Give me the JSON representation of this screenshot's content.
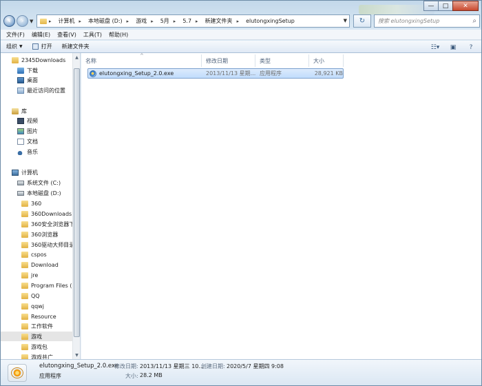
{
  "window": {
    "caption": {
      "minimize": "—",
      "maximize": "□",
      "close": "✕"
    }
  },
  "address": {
    "crumbs": [
      "计算机",
      "本地磁盘 (D:)",
      "游戏",
      "5月",
      "5.7",
      "新建文件夹",
      "elutongxingSetup"
    ]
  },
  "search": {
    "placeholder": "搜索 elutongxingSetup"
  },
  "menubar": [
    "文件(F)",
    "编辑(E)",
    "查看(V)",
    "工具(T)",
    "帮助(H)"
  ],
  "toolbar": {
    "organize": "组织",
    "open": "打开",
    "new_folder": "新建文件夹"
  },
  "nav": {
    "favorites": [
      "2345Downloads",
      "下载",
      "桌面",
      "最近访问的位置"
    ],
    "library": {
      "label": "库",
      "items": [
        "视频",
        "图片",
        "文档",
        "音乐"
      ]
    },
    "computer": {
      "label": "计算机",
      "drives": [
        "系统文件 (C:)",
        "本地磁盘 (D:)"
      ]
    },
    "folders": [
      "360",
      "360Downloads",
      "360安全浏览器下",
      "360浏览器",
      "360驱动大师目录",
      "cspos",
      "Download",
      "jre",
      "Program Files (",
      "QQ",
      "qqwj",
      "Resource",
      "工作软件",
      "游戏",
      "游戏包",
      "游戏共广"
    ]
  },
  "columns": {
    "name": "名称",
    "modified": "修改日期",
    "type": "类型",
    "size": "大小"
  },
  "files": [
    {
      "name": "elutongxing_Setup_2.0.exe",
      "modified": "2013/11/13 星期...",
      "type": "应用程序",
      "size": "28,921 KB"
    }
  ],
  "details": {
    "filename": "elutongxing_Setup_2.0.exe",
    "filetype": "应用程序",
    "modified_label": "修改日期:",
    "modified_value": "2013/11/13 星期三 10...",
    "created_label": "创建日期:",
    "created_value": "2020/5/7 星期四 9:08",
    "size_label": "大小:",
    "size_value": "28.2 MB"
  }
}
